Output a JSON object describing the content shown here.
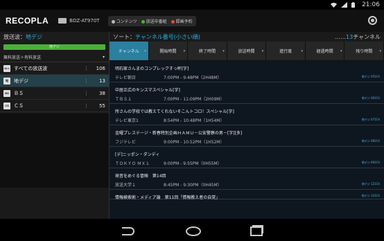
{
  "status": {
    "time": "21:06"
  },
  "app": {
    "logo": "RECOPLA",
    "device": "BDZ-AT970T"
  },
  "modes": {
    "content": "コンテンツ",
    "live": "放送中番組",
    "rec": "録画予約"
  },
  "sidebar": {
    "broadcast_label": "放送波：",
    "broadcast_value": "地デジ",
    "green_bar": "地デジ",
    "filter": "無料放送＋有料放送",
    "items": [
      {
        "icon": "ALL",
        "label": "すべての放送波",
        "count": "106"
      },
      {
        "icon": "地",
        "label": "地デジ",
        "count": "13"
      },
      {
        "icon": "BS",
        "label": "ＢＳ",
        "count": "38"
      },
      {
        "icon": "CS",
        "label": "ＣＳ",
        "count": "55"
      }
    ]
  },
  "sort": {
    "label": "ソート：",
    "value": "チャンネル番号(小さい順)",
    "count_prefix": "……",
    "count": "13",
    "count_suffix": "チャンネル"
  },
  "tabs": [
    {
      "label": "チャンネル",
      "active": true
    },
    {
      "label": "開始時間",
      "active": false
    },
    {
      "label": "終了時間",
      "active": false
    },
    {
      "label": "放送時間",
      "active": false
    },
    {
      "label": "進行度",
      "active": false
    },
    {
      "label": "経過時間",
      "active": false
    },
    {
      "label": "残り時間",
      "active": false
    }
  ],
  "programs": [
    {
      "title": "明石家さんまのコンプレックすっ杯[字]",
      "channel": "テレビ朝日",
      "time": "7:00PM - 9:48PM（2H48M）",
      "badge": "地デジ 051Ch"
    },
    {
      "title": "中居正広のキンスマスペシャル[字]",
      "channel": "ＴＢＳ１",
      "time": "7:00PM - 11:09PM（2H09M）",
      "badge": "地デジ 061Ch"
    },
    {
      "title": "所さんの学校では教えてくれないそこんトコロ！スペシャル[字]",
      "channel": "テレビ東京1",
      "time": "8:54PM - 10:48PM（1H54M）",
      "badge": "地デジ 071Ch"
    },
    {
      "title": "金曜プレステージ・新春特別企画ＨＡＭＵ－公安警察の男－[字][多]",
      "channel": "フジテレビ",
      "time": "9:00PM - 10:52PM（1H52M）",
      "badge": "地デジ 081Ch"
    },
    {
      "title": "[デ]ニッポン・ダンディ",
      "channel": "ＴＯＫＹＯ ＭＸ１",
      "time": "9:00PM - 9:55PM（0H55M）",
      "badge": "地デジ 091Ch"
    },
    {
      "title": "発音をめぐる冒険　第14回",
      "channel": "放送大学１",
      "time": "8:45PM - 9:30PM（0H45M）",
      "badge": "地デジ 121Ch"
    },
    {
      "title": "情報検索術・メディア論　第11回「情報教え者の自覚」",
      "channel": "",
      "time": "",
      "badge": "地デジ 121Ch"
    }
  ],
  "colors": {
    "accent": "#27b3e6",
    "green": "#4caf3a",
    "active_tab": "#2b7f9f"
  }
}
